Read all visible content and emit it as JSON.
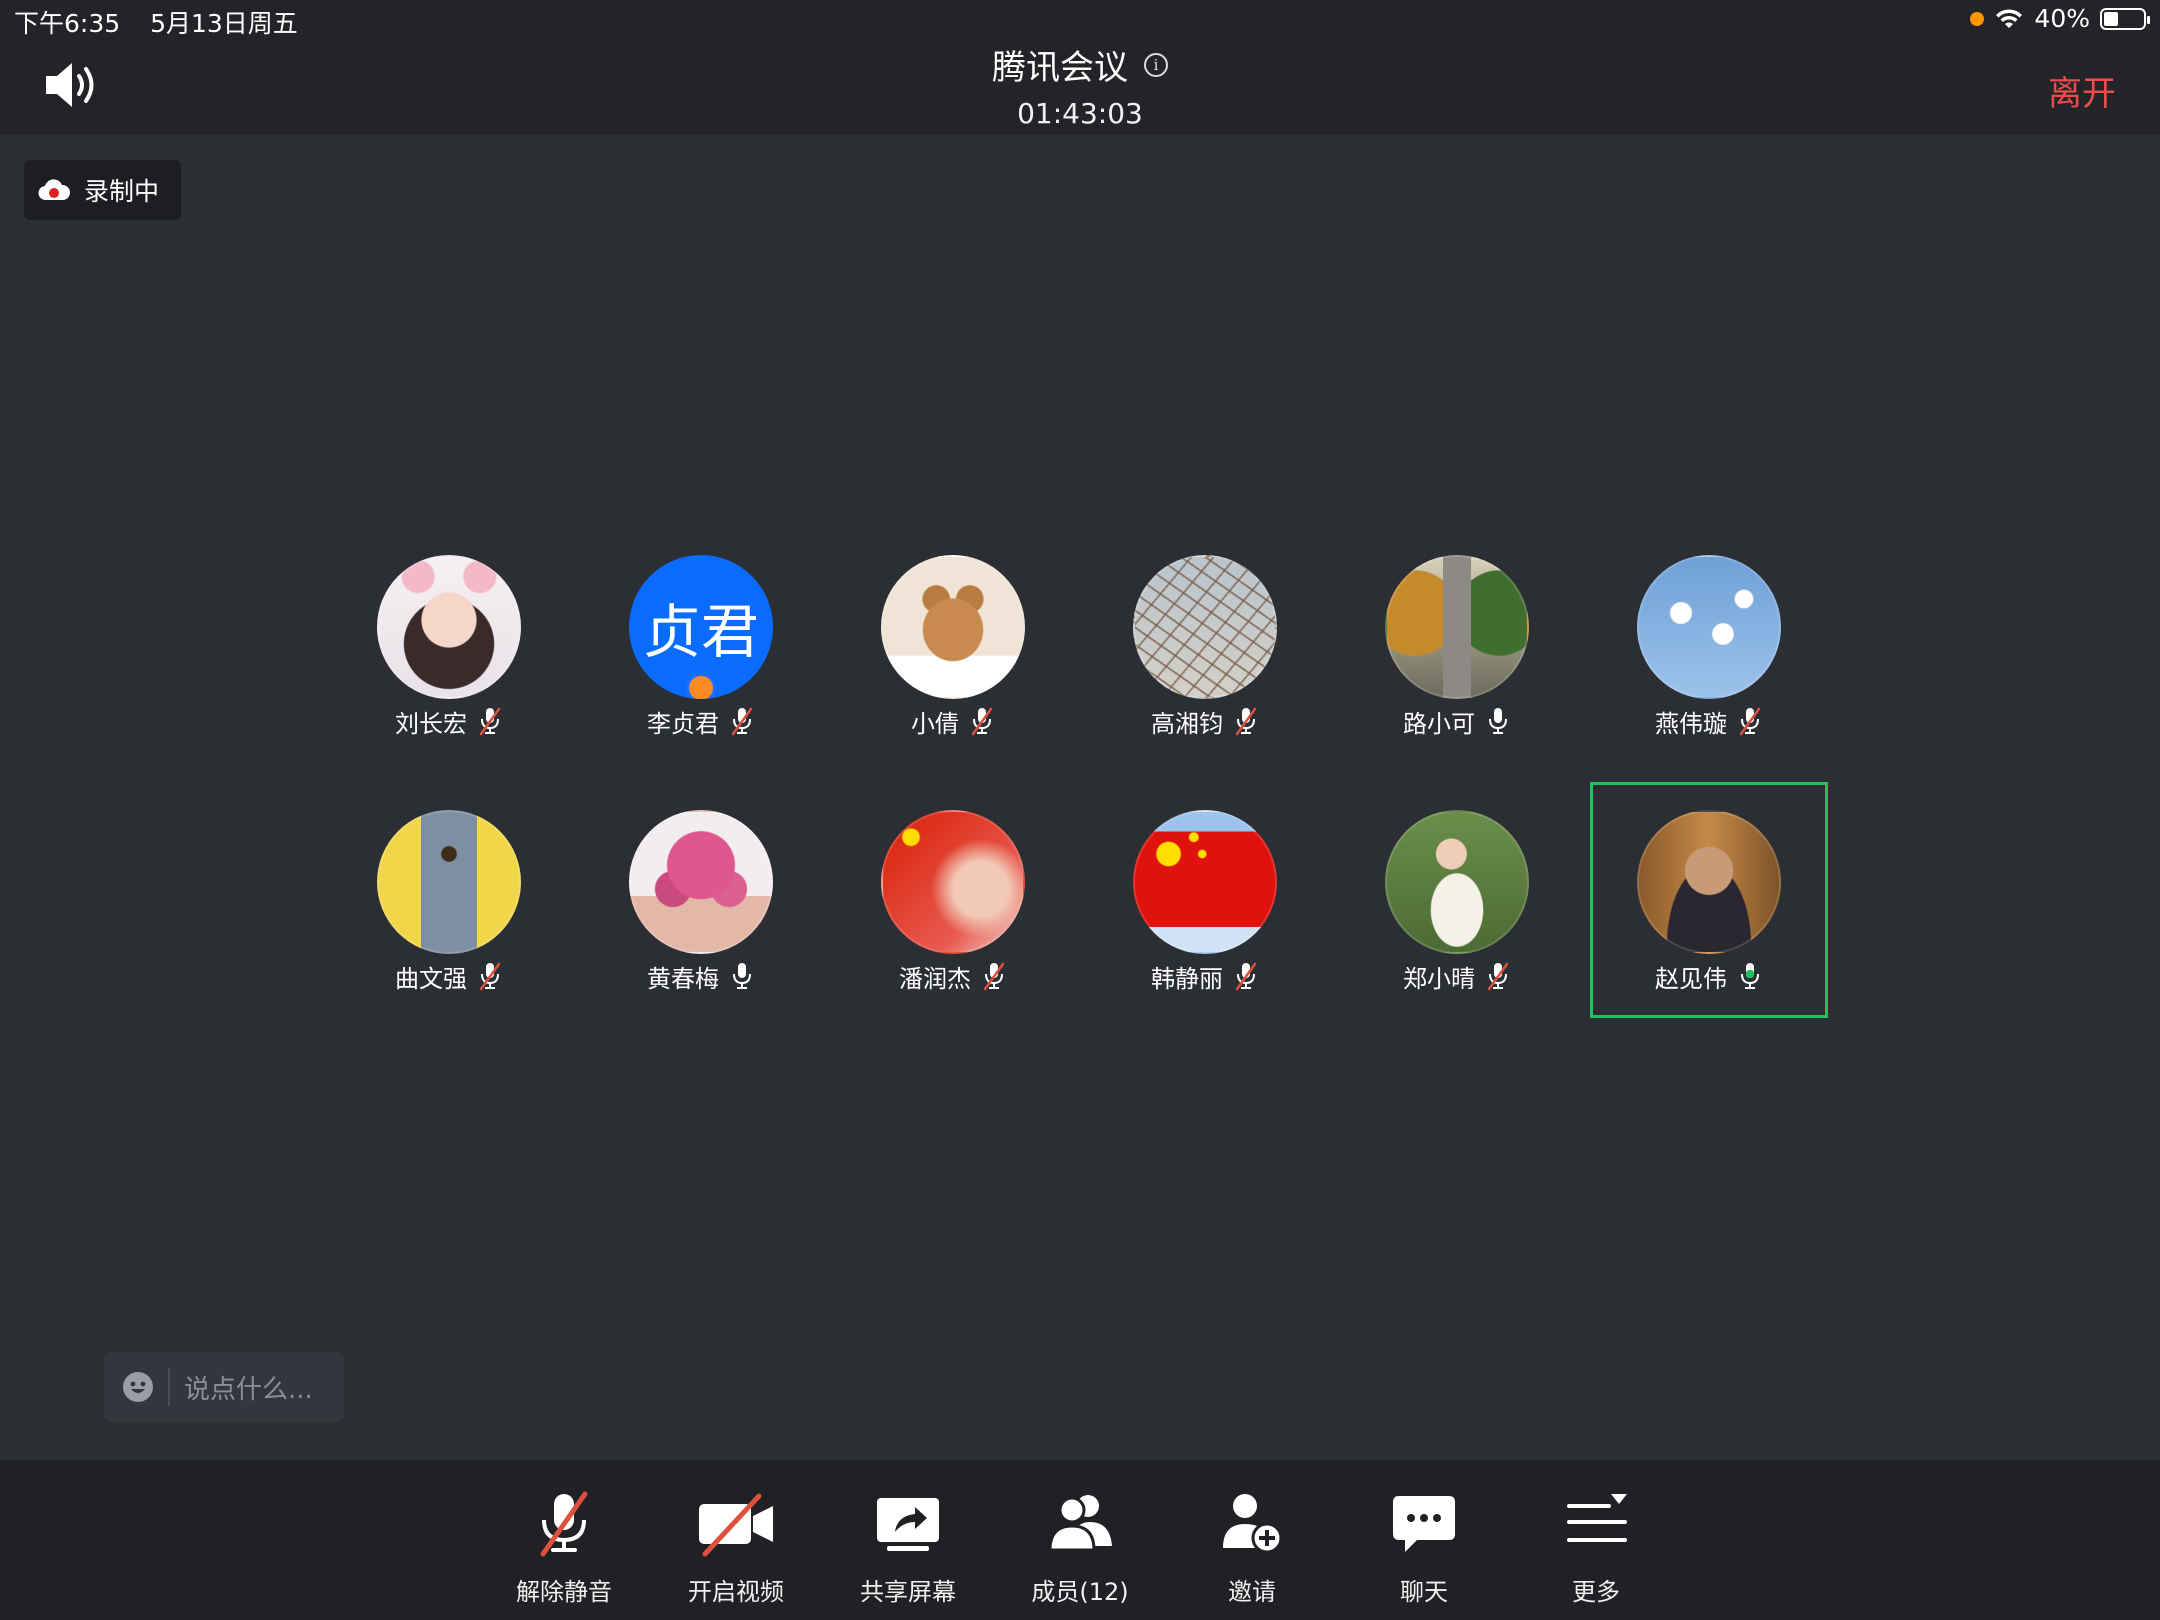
{
  "status_bar": {
    "time": "下午6:35",
    "date": "5月13日周五",
    "battery": "40%",
    "battery_level": 0.4
  },
  "header": {
    "title": "腾讯会议",
    "timer": "01:43:03",
    "leave_label": "离开"
  },
  "recording_badge": {
    "label": "录制中"
  },
  "participants": [
    {
      "name": "刘长宏",
      "mic": "muted",
      "avatar": "photo-girl-cat-ears"
    },
    {
      "name": "李贞君",
      "mic": "muted",
      "avatar_text": "贞君",
      "avatar_color": "#0a6cff",
      "host": true
    },
    {
      "name": "小倩",
      "mic": "muted",
      "avatar": "photo-cat"
    },
    {
      "name": "高湘钧",
      "mic": "muted",
      "avatar": "photo-bare-branches"
    },
    {
      "name": "路小可",
      "mic": "on",
      "avatar": "photo-autumn-road"
    },
    {
      "name": "燕伟璇",
      "mic": "muted",
      "avatar": "photo-blue-sky"
    },
    {
      "name": "曲文强",
      "mic": "muted",
      "avatar": "photo-painted-tree"
    },
    {
      "name": "黄春梅",
      "mic": "on",
      "avatar": "photo-pink-flowers"
    },
    {
      "name": "潘润杰",
      "mic": "muted",
      "avatar": "photo-flag-portrait"
    },
    {
      "name": "韩静丽",
      "mic": "muted",
      "avatar": "photo-china-flag"
    },
    {
      "name": "郑小晴",
      "mic": "muted",
      "avatar": "photo-violinist"
    },
    {
      "name": "赵见伟",
      "mic": "speaking",
      "avatar": "photo-man-glasses",
      "active": true
    }
  ],
  "chat_input": {
    "placeholder": "说点什么..."
  },
  "toolbar": {
    "unmute": "解除静音",
    "video": "开启视频",
    "share": "共享屏幕",
    "members": "成员(12)",
    "invite": "邀请",
    "chat": "聊天",
    "more": "更多"
  },
  "colors": {
    "leave": "#f04b4b",
    "speaking": "#1fc25e",
    "mute_slash": "#e0503f",
    "recording_dot": "#e02020"
  }
}
